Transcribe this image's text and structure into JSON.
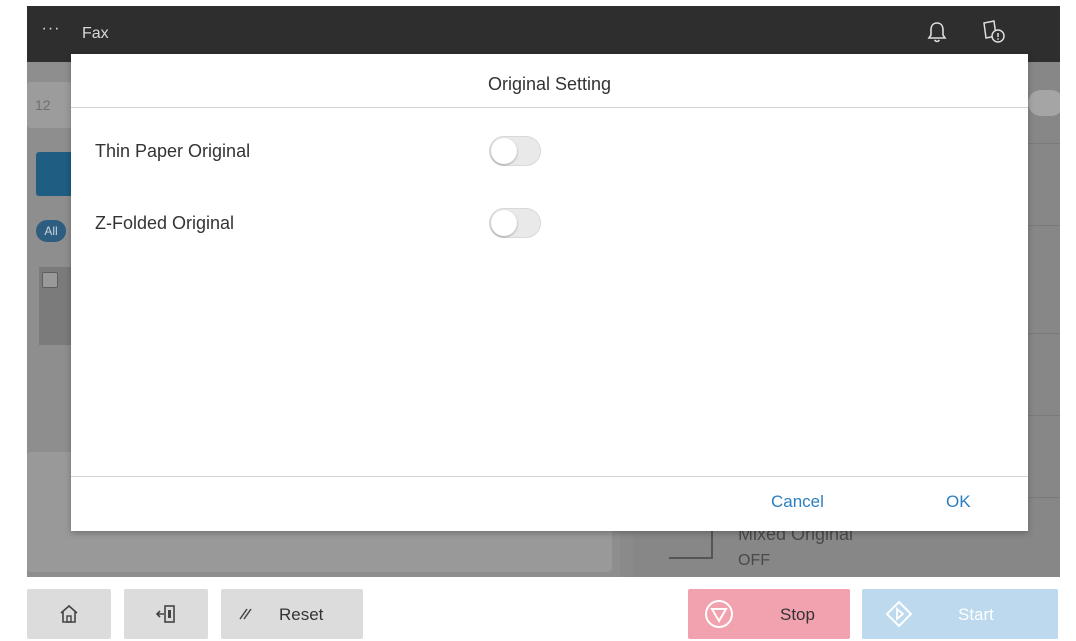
{
  "topbar": {
    "menu_glyph": "···",
    "title": "Fax",
    "icons": [
      "bell-icon",
      "notification-icon"
    ]
  },
  "background": {
    "destination_partial": "12",
    "filter_pill": "All",
    "mixed_original_label": "Mixed Original",
    "mixed_original_value": "OFF"
  },
  "dialog": {
    "title": "Original Setting",
    "options": [
      {
        "label": "Thin Paper Original",
        "enabled": false
      },
      {
        "label": "Z-Folded Original",
        "enabled": false
      }
    ],
    "cancel_label": "Cancel",
    "ok_label": "OK",
    "accent": "#2b7fc1"
  },
  "bottombar": {
    "home_icon": "home-icon",
    "logout_icon": "logout-icon",
    "reset_label": "Reset",
    "stop_label": "Stop",
    "start_label": "Start",
    "stop_color": "#f2a2ae",
    "start_color": "#bcd9ee"
  }
}
